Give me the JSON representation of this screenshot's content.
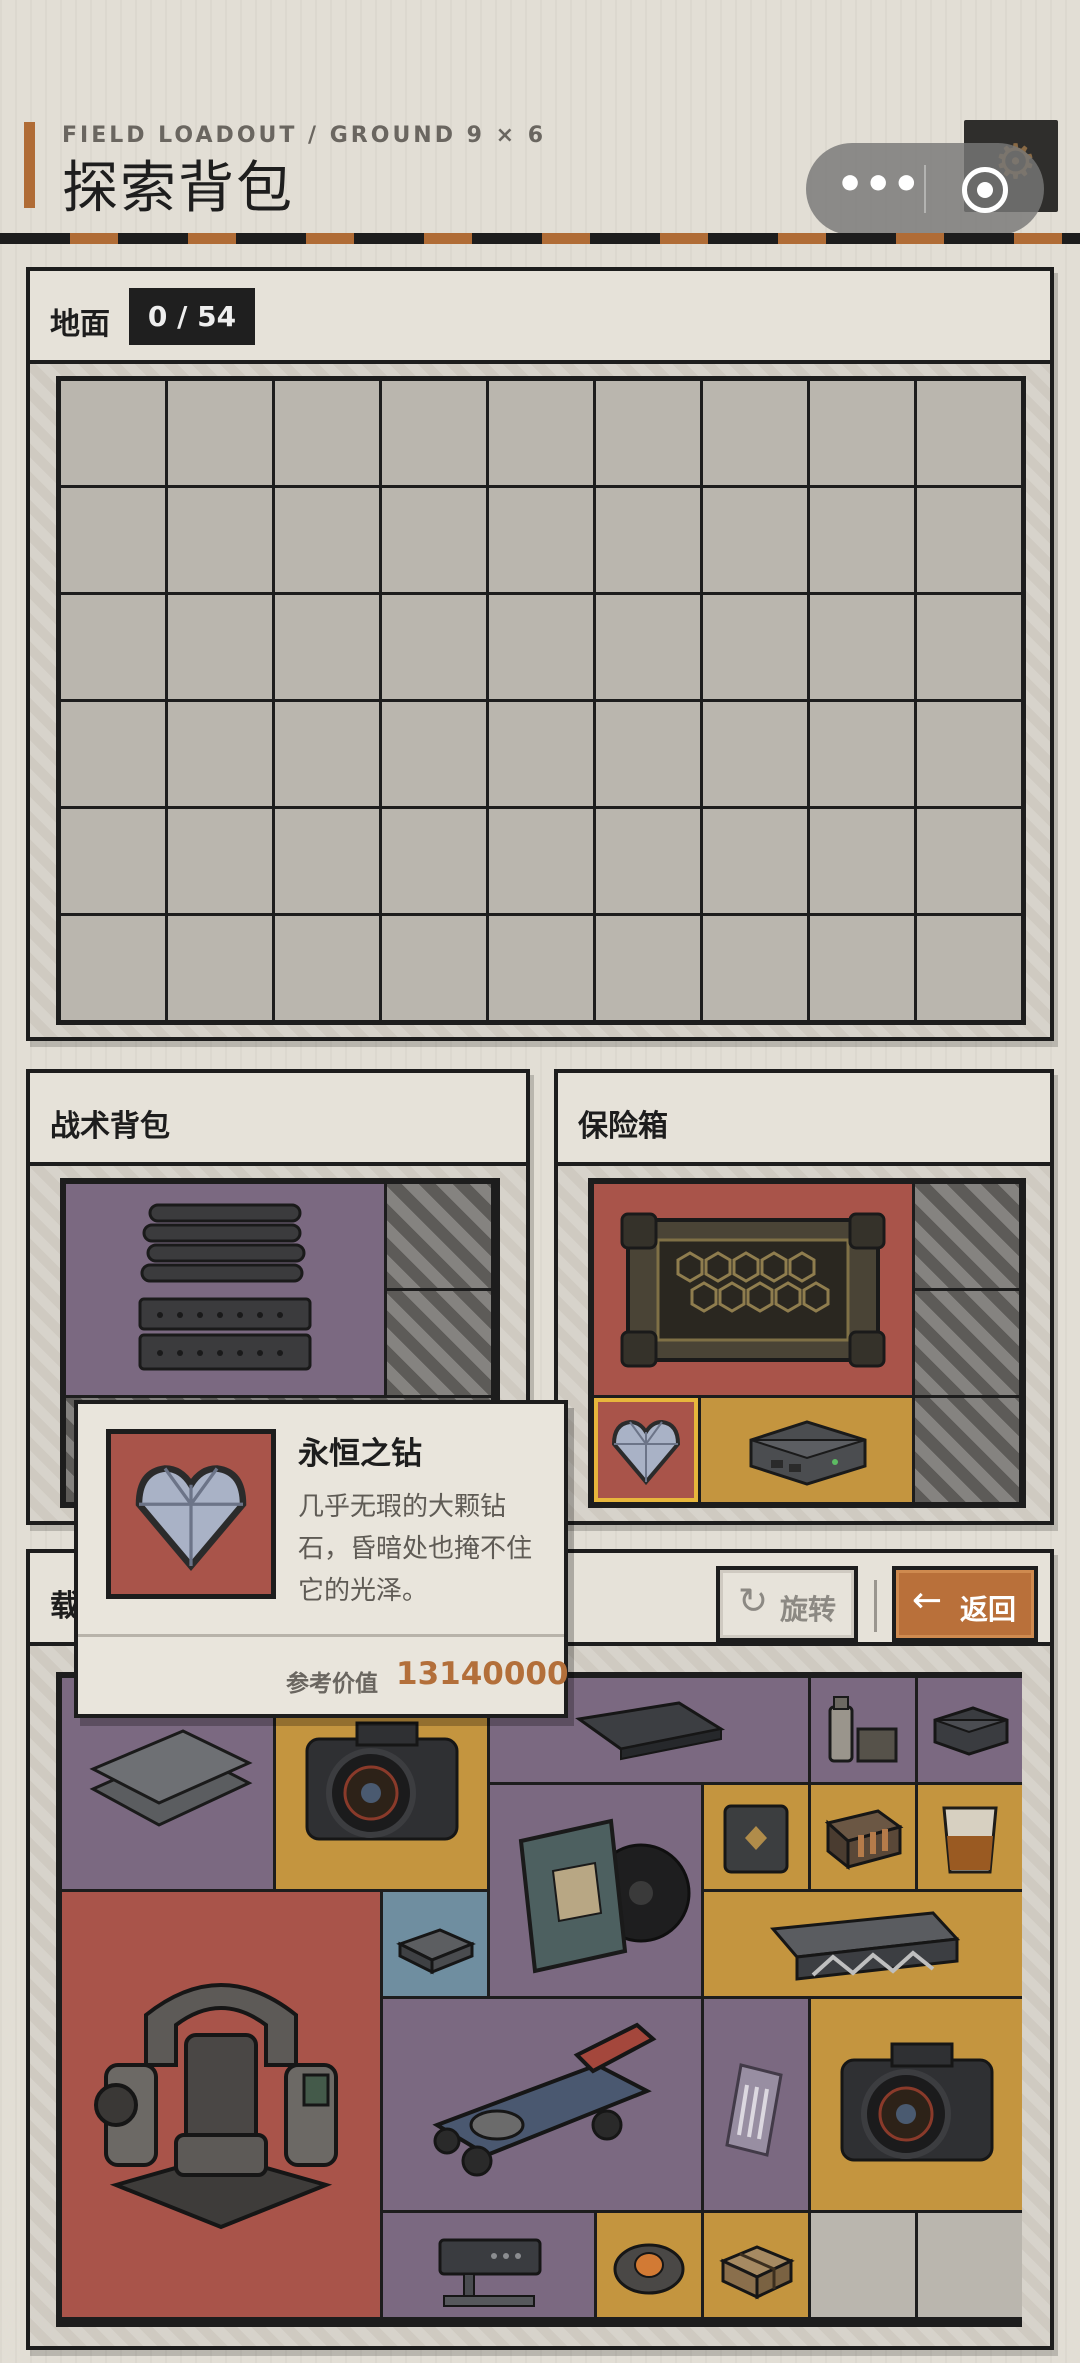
{
  "header": {
    "subtitle": "FIELD LOADOUT / GROUND 9 × 6",
    "title": "探索背包"
  },
  "ground": {
    "title": "地面",
    "count": "0 / 54",
    "columns": 9,
    "rows": 6
  },
  "tactical_bag": {
    "title": "战术背包"
  },
  "safe_box": {
    "title": "保险箱"
  },
  "carry": {
    "title_visible": "载"
  },
  "actions": {
    "rotate_label": "旋转",
    "back_label": "返回"
  },
  "tooltip": {
    "name": "永恒之钻",
    "description": "几乎无瑕的大颗钻石，昏暗处也掩不住它的光泽。",
    "value_label": "参考价值",
    "value": "13140000"
  },
  "colors": {
    "accent": "#b06c36",
    "rarity_purple": "#7b6981",
    "rarity_red": "#a9544a",
    "rarity_gold": "#c4953f",
    "rarity_blue": "#6f8ea0",
    "empty_slot": "#bab6ae"
  },
  "icons": {
    "capsule_more": "more-dots-icon",
    "capsule_close": "target-circle-icon",
    "settings": "gear-icon",
    "rotate": "rotate-icon",
    "back": "arrow-left-icon"
  }
}
